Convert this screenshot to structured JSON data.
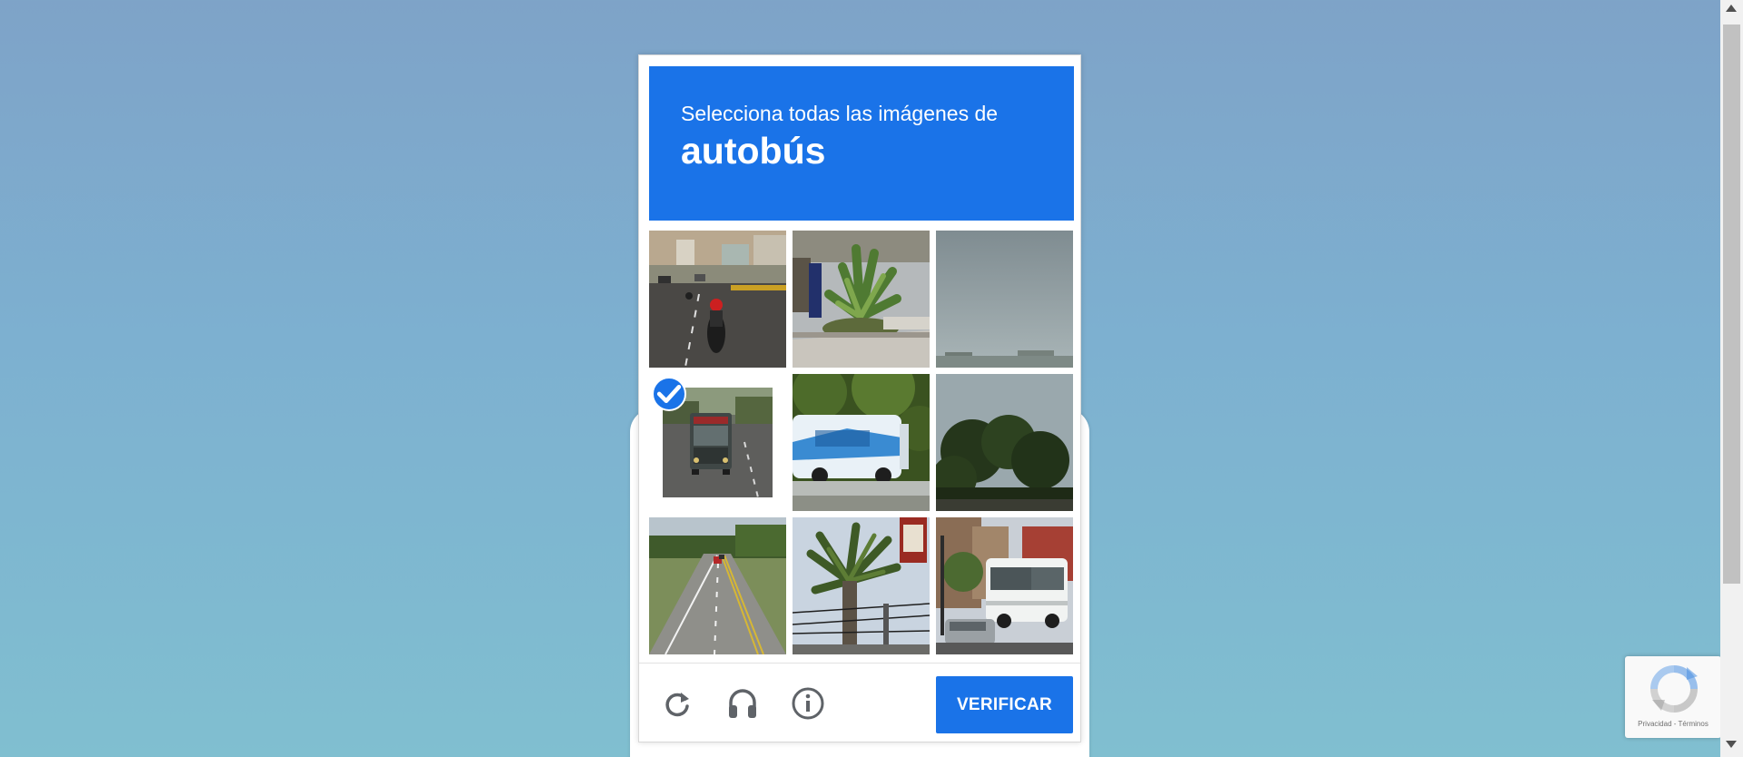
{
  "challenge": {
    "instruction": "Selecciona todas las imágenes de",
    "target_object": "autobús",
    "accent_color": "#1a73e8",
    "tiles": [
      {
        "scene": "highway-with-motorcyclist",
        "selected": false
      },
      {
        "scene": "palm-tree-planter",
        "selected": false
      },
      {
        "scene": "overcast-sky",
        "selected": false
      },
      {
        "scene": "bus-on-road",
        "selected": true
      },
      {
        "scene": "white-bus-with-trees",
        "selected": false
      },
      {
        "scene": "trees-and-sky",
        "selected": false
      },
      {
        "scene": "two-lane-road",
        "selected": false
      },
      {
        "scene": "palm-tree-power-lines",
        "selected": false
      },
      {
        "scene": "white-bus-on-street",
        "selected": false
      }
    ],
    "footer": {
      "reload_icon": "reload-icon",
      "audio_icon": "headphones-icon",
      "info_icon": "info-icon",
      "verify_label": "VERIFICAR"
    }
  },
  "recaptcha_badge": {
    "links": "Privacidad - Términos"
  }
}
